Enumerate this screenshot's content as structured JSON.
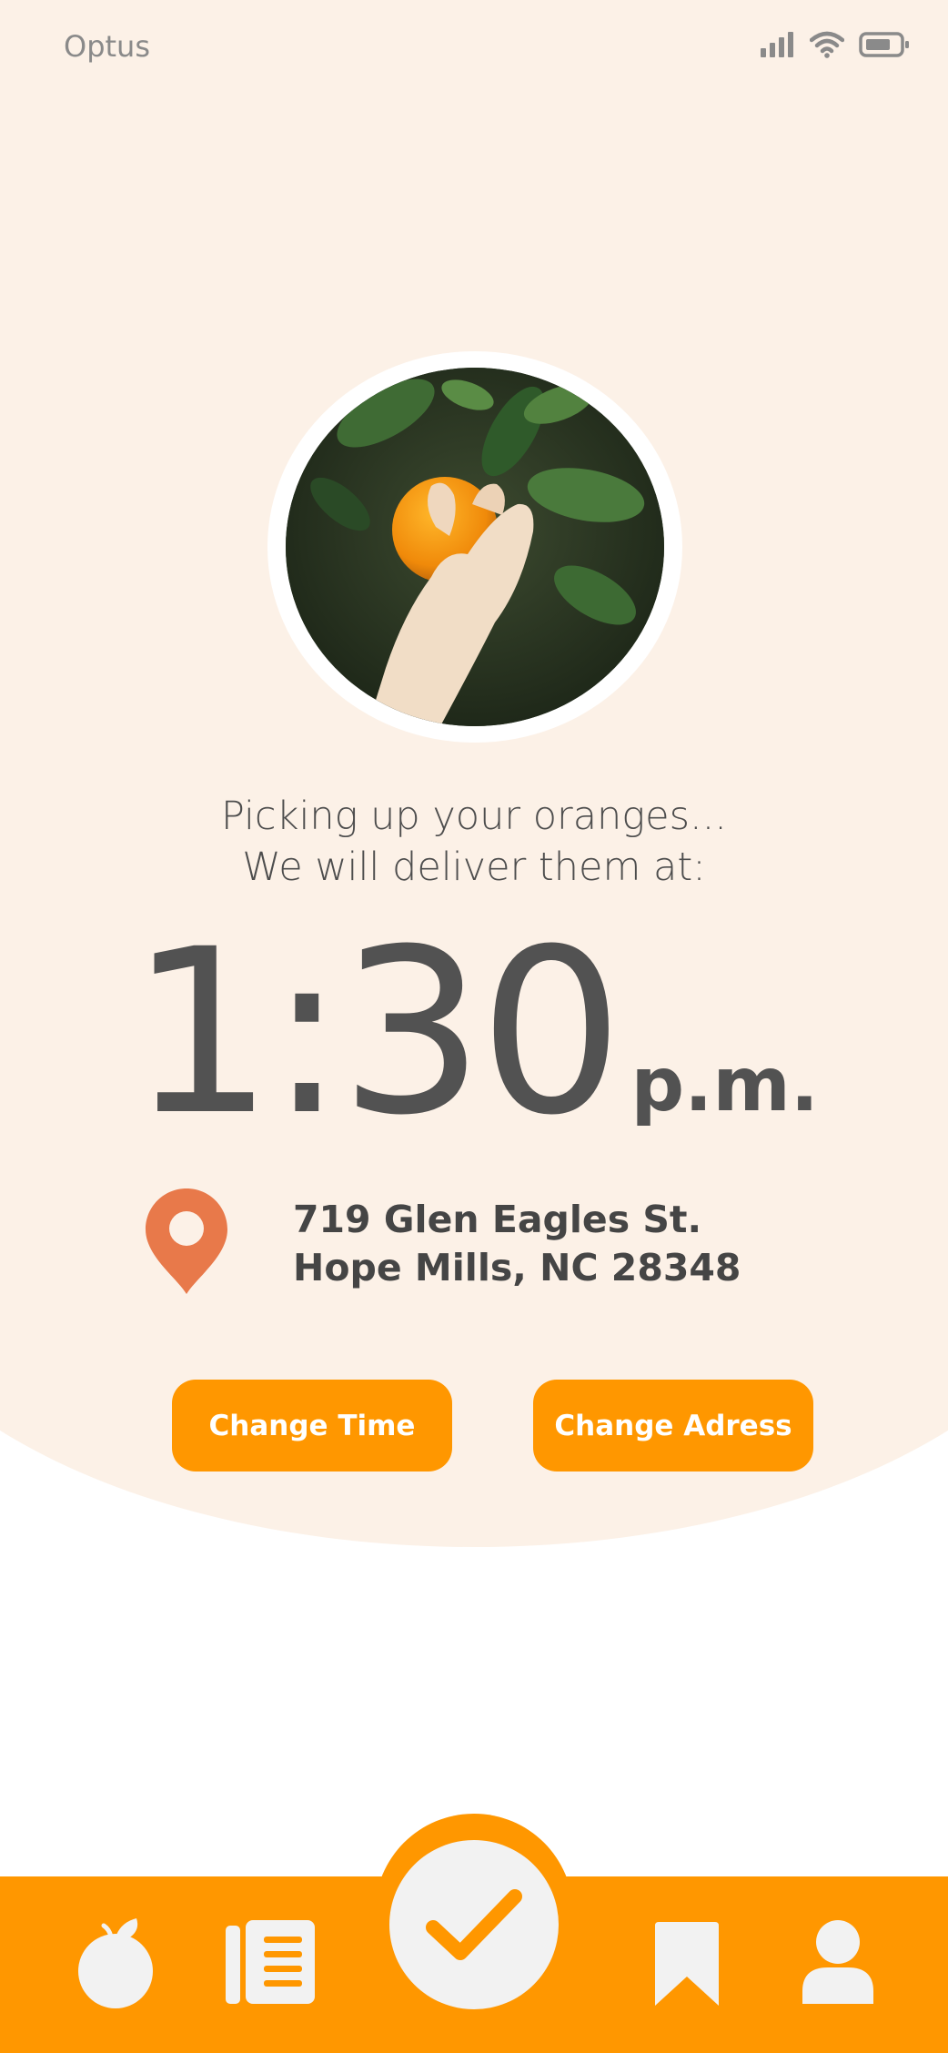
{
  "status_bar": {
    "carrier": "Optus",
    "icons": [
      "signal-icon",
      "wifi-icon",
      "battery-icon"
    ]
  },
  "hero": {
    "image": "hand-picking-orange-photo"
  },
  "message": {
    "line1": "Picking up your oranges...",
    "line2": "We will deliver them at:"
  },
  "delivery": {
    "time": "1:30",
    "meridiem": "p.m.",
    "address_line1": "719 Glen Eagles St.",
    "address_line2": "Hope Mills, NC 28348"
  },
  "actions": {
    "change_time": "Change Time",
    "change_address": "Change Adress"
  },
  "nav": {
    "items": [
      "orange-icon",
      "list-icon",
      "check-icon",
      "bookmark-icon",
      "user-icon"
    ],
    "active": "check-icon"
  },
  "colors": {
    "accent": "#ff9700",
    "background": "#fcf1e7",
    "pin": "#e8794a",
    "text": "#525252"
  }
}
